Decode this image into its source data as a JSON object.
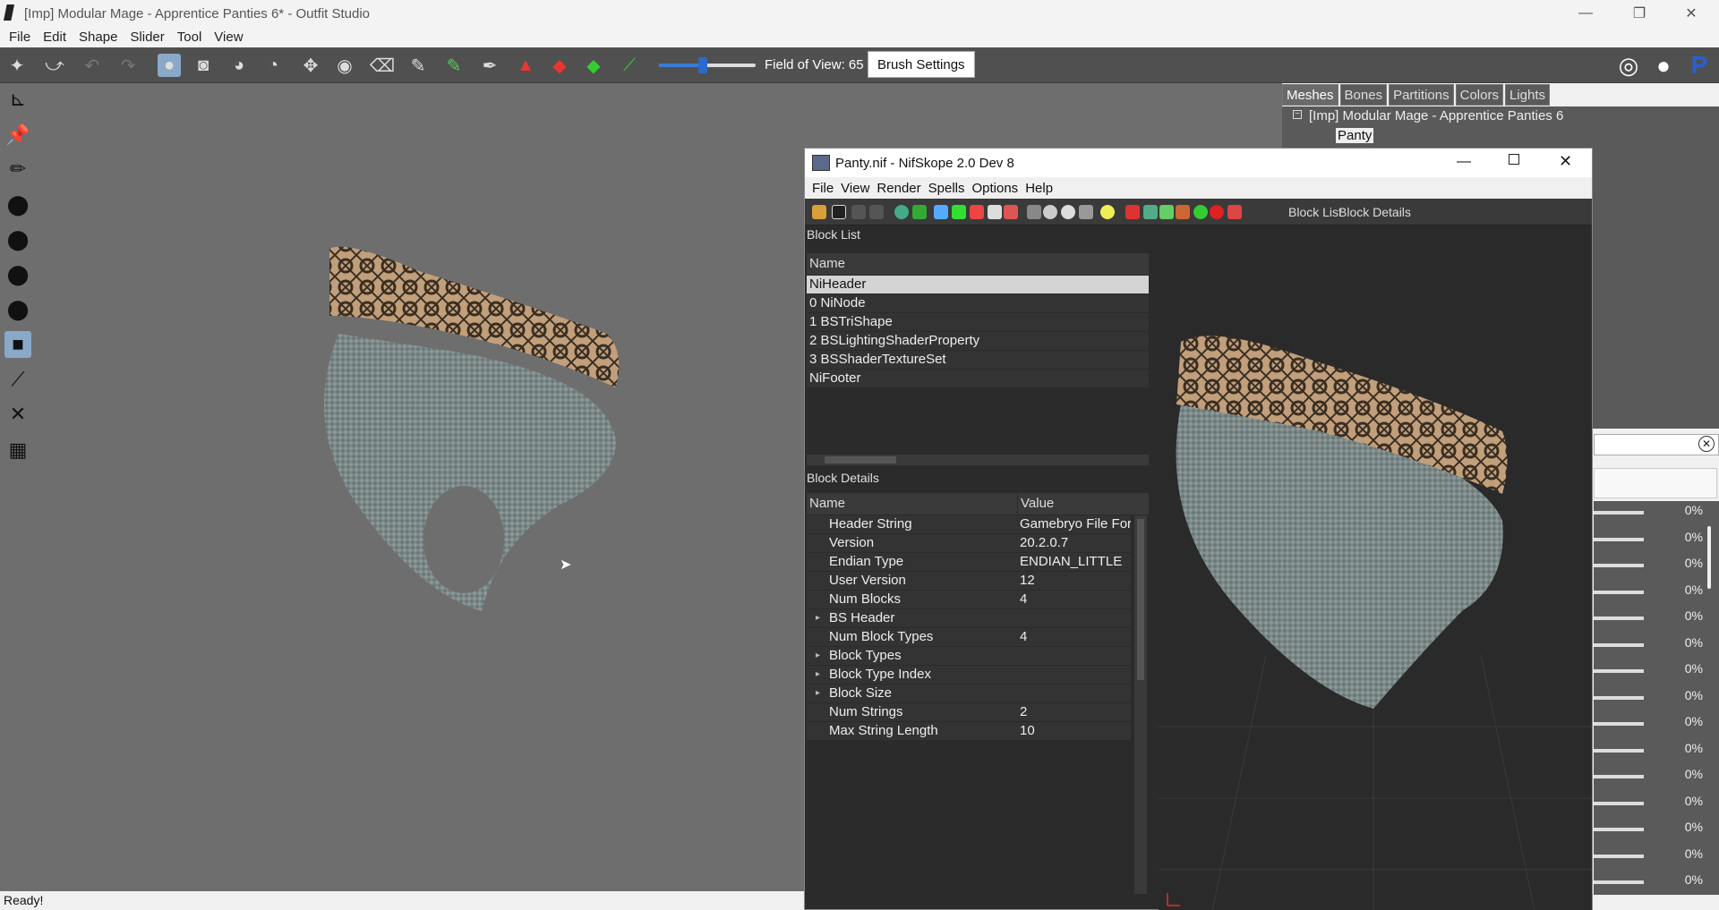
{
  "outfit_studio": {
    "title": "[Imp] Modular Mage - Apprentice Panties 6* - Outfit Studio",
    "menu": [
      "File",
      "Edit",
      "Shape",
      "Slider",
      "Tool",
      "View"
    ],
    "toolbar": {
      "fov_label": "Field of View: 65",
      "fov_value": 0.45,
      "brush_settings_label": "Brush Settings"
    },
    "tabs": [
      "Meshes",
      "Bones",
      "Partitions",
      "Colors",
      "Lights"
    ],
    "active_tab": "Meshes",
    "tree": {
      "root": "[Imp] Modular Mage - Apprentice Panties 6",
      "child": "Panty"
    },
    "slider_values": [
      "0%",
      "0%",
      "0%",
      "0%",
      "0%",
      "0%",
      "0%",
      "0%",
      "0%",
      "0%",
      "0%",
      "0%",
      "0%",
      "0%",
      "0%"
    ],
    "status": "Ready!"
  },
  "nifskope": {
    "title": "Panty.nif - NifSkope 2.0 Dev 8",
    "menu": [
      "File",
      "View",
      "Render",
      "Spells",
      "Options",
      "Help"
    ],
    "toolbar_tabs": [
      "Block List",
      "Block Details"
    ],
    "block_list": {
      "title": "Block List",
      "header": "Name",
      "rows": [
        "NiHeader",
        "0 NiNode",
        "1 BSTriShape",
        "2 BSLightingShaderProperty",
        "3 BSShaderTextureSet",
        "NiFooter"
      ],
      "selected": "NiHeader"
    },
    "block_details": {
      "title": "Block Details",
      "headers": [
        "Name",
        "Value"
      ],
      "rows": [
        {
          "name": "Header String",
          "value": "Gamebryo File Forr",
          "expand": false
        },
        {
          "name": "Version",
          "value": "20.2.0.7",
          "expand": false
        },
        {
          "name": "Endian Type",
          "value": "ENDIAN_LITTLE",
          "expand": false
        },
        {
          "name": "User Version",
          "value": "12",
          "expand": false
        },
        {
          "name": "Num Blocks",
          "value": "4",
          "expand": false
        },
        {
          "name": "BS Header",
          "value": "",
          "expand": true
        },
        {
          "name": "Num Block Types",
          "value": "4",
          "expand": false
        },
        {
          "name": "Block Types",
          "value": "",
          "expand": true
        },
        {
          "name": "Block Type Index",
          "value": "",
          "expand": true
        },
        {
          "name": "Block Size",
          "value": "",
          "expand": true
        },
        {
          "name": "Num Strings",
          "value": "2",
          "expand": false
        },
        {
          "name": "Max String Length",
          "value": "10",
          "expand": false
        }
      ]
    }
  }
}
